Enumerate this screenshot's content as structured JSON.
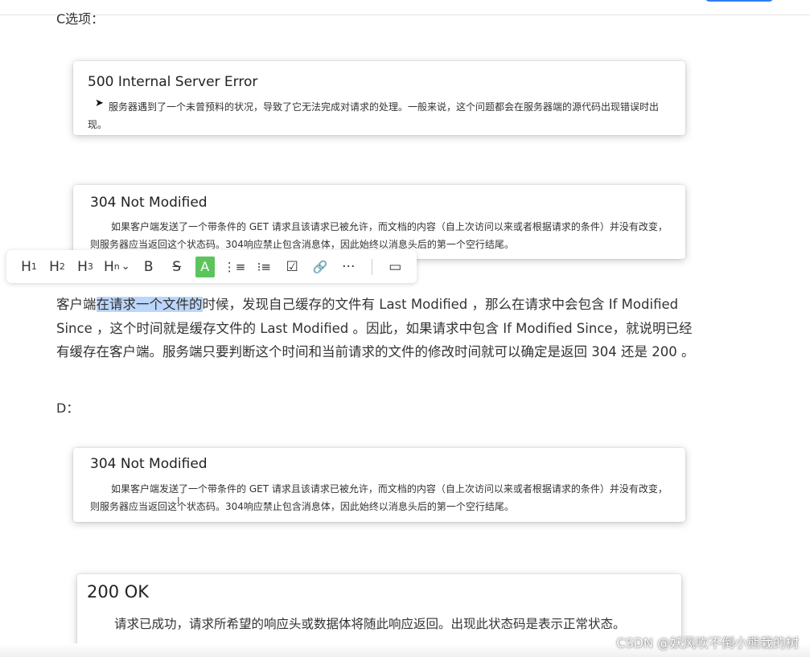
{
  "sections": {
    "c_label": "C选项：",
    "d_label": "D："
  },
  "cards": {
    "card1": {
      "title": "500 Internal Server Error",
      "body": "服务器遇到了一个未曾预料的状况，导致了它无法完成对请求的处理。一般来说，这个问题都会在服务器端的源代码出现错误时出现。"
    },
    "card2": {
      "title": "304 Not Modified",
      "body": "如果客户端发送了一个带条件的 GET 请求且该请求已被允许，而文档的内容（自上次访问以来或者根据请求的条件）并没有改变，则服务器应当返回这个状态码。304响应禁止包含消息体，因此始终以消息头后的第一个空行结尾。"
    },
    "card3": {
      "title": "304 Not Modified",
      "body": "如果客户端发送了一个带条件的 GET 请求且该请求已被允许，而文档的内容（自上次访问以来或者根据请求的条件）并没有改变，则服务器应当返回这个状态码。304响应禁止包含消息体，因此始终以消息头后的第一个空行结尾。"
    },
    "card4": {
      "title": "200 OK",
      "body": "请求已成功，请求所希望的响应头或数据体将随此响应返回。出现此状态码是表示正常状态。"
    }
  },
  "toolbar": {
    "h1": "H",
    "h1_sub": "1",
    "h2": "H",
    "h2_sub": "2",
    "h3": "H",
    "h3_sub": "3",
    "hn": "H",
    "hn_sub": "n",
    "hn_chevron": "⌄",
    "bold": "B",
    "strike": "S",
    "highlight": "A",
    "ordered_list": "⋮≡",
    "bullet_list": "⁝≡",
    "task_list": "☑",
    "link": "🔗",
    "more": "···",
    "comment": "▭",
    "icons": {
      "ordered_list": "ordered-list-icon",
      "bullet_list": "bullet-list-icon",
      "task_list": "checkbox-icon",
      "link": "link-icon",
      "more": "more-icon",
      "comment": "comment-icon"
    },
    "highlight_color": "#5cc45c"
  },
  "paragraph": {
    "before_sel": "客户端",
    "selected": "在请求一个文件的",
    "after_sel": "时候，发现自己缓存的文件有 Last Modified ，那么在请求中会包含 If Modified Since ，这个时间就是缓存文件的 Last Modified 。因此，如果请求中包含 If Modified Since，就说明已经有缓存在客户端。服务端只要判断这个时间和当前请求的文件的修改时间就可以确定是返回 304 还是 200 。",
    "selection_color": "#bcd6fb"
  },
  "watermark": "CSDN @妖风吹不倒小熊栽的树",
  "colors": {
    "accent": "#2f7cf6"
  }
}
